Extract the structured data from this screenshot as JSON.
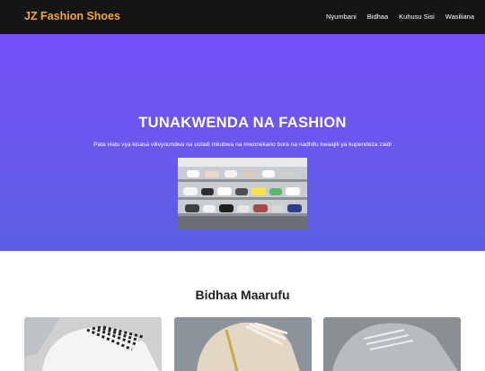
{
  "header": {
    "brand": "JZ Fashion Shoes",
    "nav": [
      "Nyumbani",
      "Bidhaa",
      "Kuhusu Sisi",
      "Wasiliana"
    ]
  },
  "hero": {
    "title": "TUNAKWENDA NA FASHION",
    "subtitle": "Pata viatu vya kisasa vilivyoundwa na ustadi mkubwa na mwonekano bora na nadhifu kwaajili ya kupendeza zaidi"
  },
  "products": {
    "title": "Bidhaa Maarufu"
  },
  "colors": {
    "brand": "#f0a63a",
    "nav_bg": "#151515",
    "hero_top": "#7550f4",
    "hero_bottom": "#5b5fe0"
  }
}
